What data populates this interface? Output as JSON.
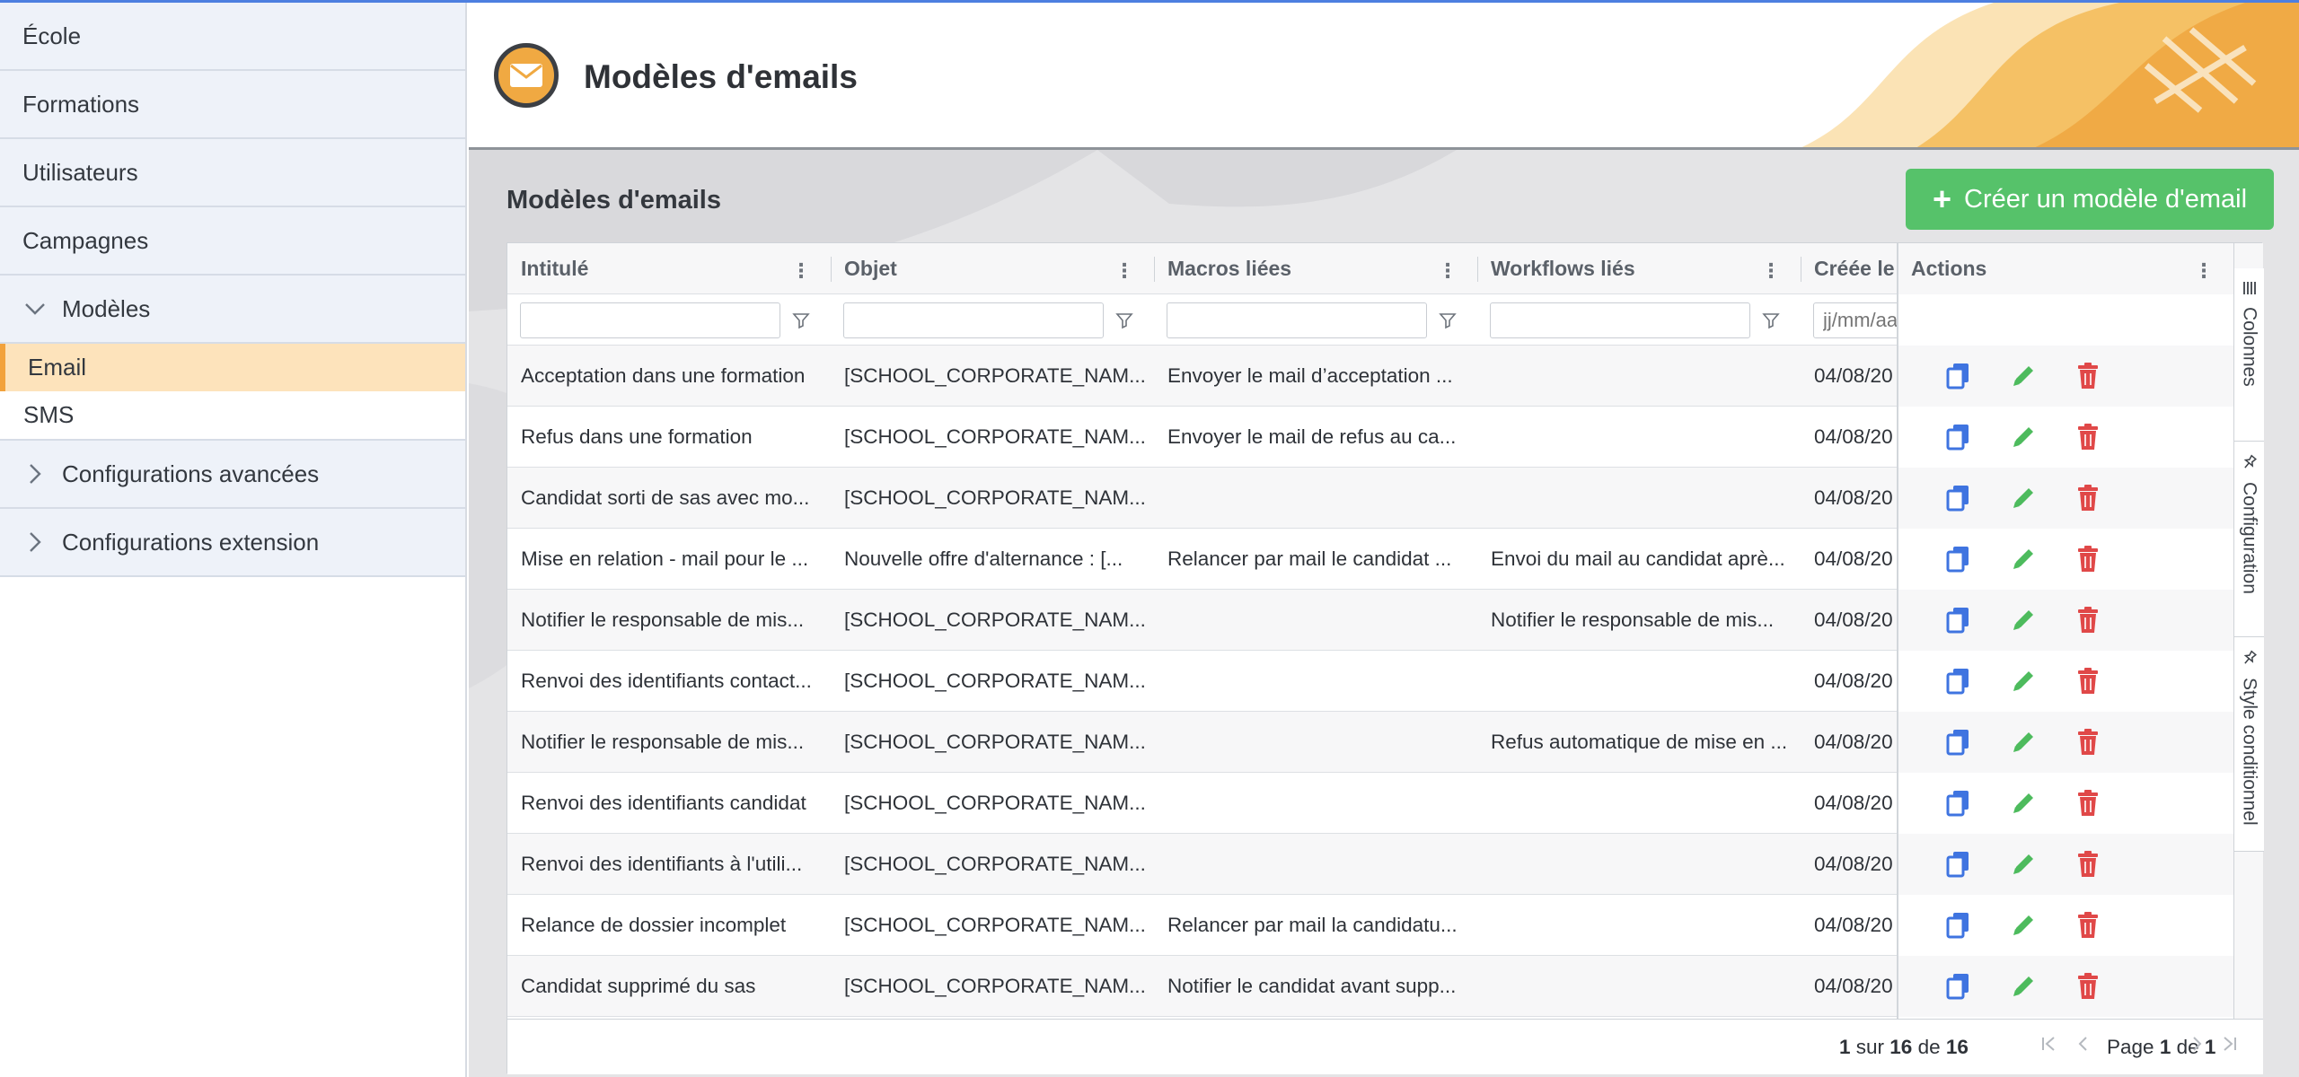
{
  "sidebar": {
    "items": [
      {
        "label": "École"
      },
      {
        "label": "Formations"
      },
      {
        "label": "Utilisateurs"
      },
      {
        "label": "Campagnes"
      }
    ],
    "modeles": {
      "label": "Modèles",
      "children": [
        {
          "label": "Email",
          "active": true
        },
        {
          "label": "SMS",
          "active": false
        }
      ]
    },
    "config_avancees": {
      "label": "Configurations avancées"
    },
    "config_extension": {
      "label": "Configurations extension"
    }
  },
  "header": {
    "title": "Modèles d'emails",
    "icon": "envelope-icon"
  },
  "main": {
    "section_title": "Modèles d'emails",
    "create_button": "Créer un modèle d'email"
  },
  "grid": {
    "columns": [
      {
        "label": "Intitulé"
      },
      {
        "label": "Objet"
      },
      {
        "label": "Macros liées"
      },
      {
        "label": "Workflows liés"
      },
      {
        "label": "Créée le"
      },
      {
        "label": "Actions"
      }
    ],
    "date_filter_placeholder": "jj/mm/aaaa",
    "rows": [
      {
        "intitule": "Acceptation dans une formation",
        "objet": "[SCHOOL_CORPORATE_NAM...",
        "macros": "Envoyer le mail d’acceptation ...",
        "workflows": "",
        "date": "04/08/20"
      },
      {
        "intitule": "Refus dans une formation",
        "objet": "[SCHOOL_CORPORATE_NAM...",
        "macros": "Envoyer le mail de refus au ca...",
        "workflows": "",
        "date": "04/08/20"
      },
      {
        "intitule": "Candidat sorti de sas avec mo...",
        "objet": "[SCHOOL_CORPORATE_NAM...",
        "macros": "",
        "workflows": "",
        "date": "04/08/20"
      },
      {
        "intitule": "Mise en relation - mail pour le ...",
        "objet": "Nouvelle offre d'alternance : [...",
        "macros": "Relancer par mail le candidat ...",
        "workflows": "Envoi du mail au candidat aprè...",
        "date": "04/08/20"
      },
      {
        "intitule": "Notifier le responsable de mis...",
        "objet": "[SCHOOL_CORPORATE_NAM...",
        "macros": "",
        "workflows": "Notifier le responsable de mis...",
        "date": "04/08/20"
      },
      {
        "intitule": "Renvoi des identifiants contact...",
        "objet": "[SCHOOL_CORPORATE_NAM...",
        "macros": "",
        "workflows": "",
        "date": "04/08/20"
      },
      {
        "intitule": "Notifier le responsable de mis...",
        "objet": "[SCHOOL_CORPORATE_NAM...",
        "macros": "",
        "workflows": "Refus automatique de mise en ...",
        "date": "04/08/20"
      },
      {
        "intitule": "Renvoi des identifiants candidat",
        "objet": "[SCHOOL_CORPORATE_NAM...",
        "macros": "",
        "workflows": "",
        "date": "04/08/20"
      },
      {
        "intitule": "Renvoi des identifiants à l'utili...",
        "objet": "[SCHOOL_CORPORATE_NAM...",
        "macros": "",
        "workflows": "",
        "date": "04/08/20"
      },
      {
        "intitule": "Relance de dossier incomplet",
        "objet": "[SCHOOL_CORPORATE_NAM...",
        "macros": "Relancer par mail la candidatu...",
        "workflows": "",
        "date": "04/08/20"
      },
      {
        "intitule": "Candidat supprimé du sas",
        "objet": "[SCHOOL_CORPORATE_NAM...",
        "macros": "Notifier le candidat avant supp...",
        "workflows": "",
        "date": "04/08/20"
      }
    ],
    "side_tabs": [
      {
        "label": "Colonnes",
        "icon": "columns-icon"
      },
      {
        "label": "Configuration",
        "icon": "pin-icon"
      },
      {
        "label": "Style conditionnel",
        "icon": "pin-icon"
      }
    ],
    "footer": {
      "range_from": "1",
      "range_sep1": " sur ",
      "range_to": "16",
      "range_sep2": " de ",
      "total": "16",
      "page_label": "Page ",
      "page_current": "1",
      "page_sep": " de ",
      "page_total": "1"
    }
  },
  "colors": {
    "accent_orange": "#f2a23c",
    "create_green": "#56c26a",
    "copy_blue": "#3f74e0",
    "edit_green": "#4dbb5d",
    "delete_red": "#e04848"
  }
}
